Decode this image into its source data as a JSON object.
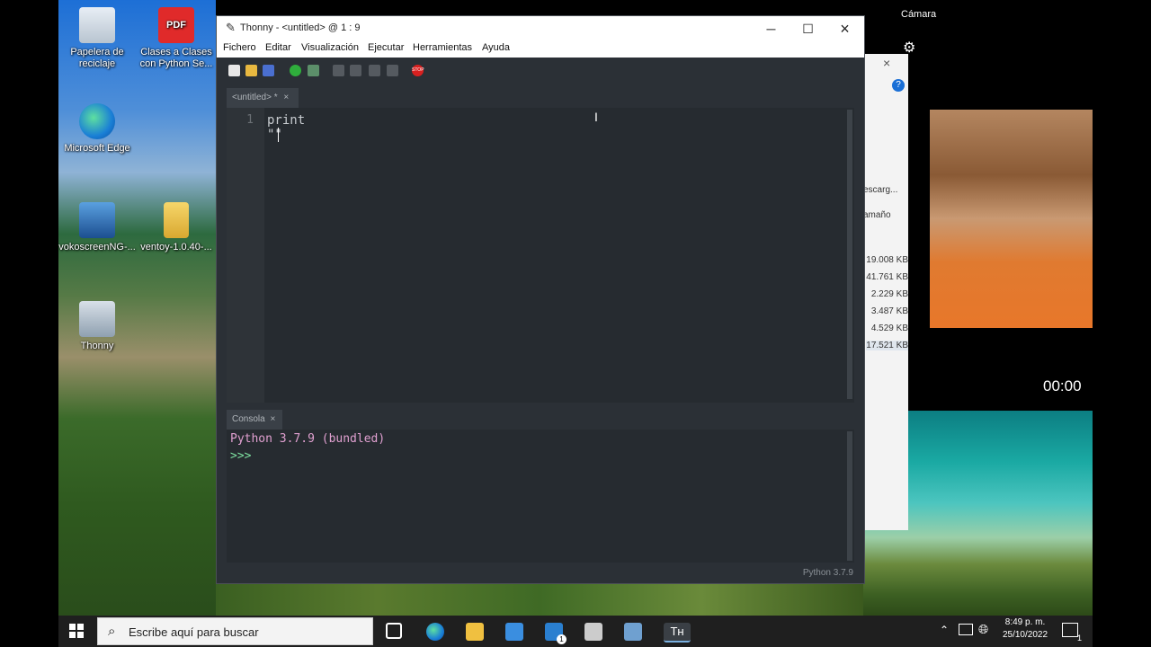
{
  "desktop": {
    "icons": [
      {
        "label": "Papelera de reciclaje",
        "icon": "recycle-bin-icon"
      },
      {
        "label": "Clases a Clases con Python Se...",
        "icon": "pdf-icon",
        "badge": "PDF"
      },
      {
        "label": "Microsoft Edge",
        "icon": "edge-icon"
      },
      {
        "label": "vokoscreenNG-...",
        "icon": "vokoscreen-icon"
      },
      {
        "label": "ventoy-1.0.40-...",
        "icon": "folder-zip-icon"
      },
      {
        "label": "Thonny",
        "icon": "thonny-icon"
      }
    ]
  },
  "thonny": {
    "title": "Thonny  -  <untitled>  @  1 : 9",
    "menu": [
      "Fichero",
      "Editar",
      "Visualización",
      "Ejecutar",
      "Herramientas",
      "Ayuda"
    ],
    "toolbar": [
      "new-file-icon",
      "open-file-icon",
      "save-icon",
      "run-icon",
      "debug-icon",
      "step-over-icon",
      "step-into-icon",
      "step-out-icon",
      "resume-icon",
      "stop-icon"
    ],
    "stop_label": "STOP",
    "editor_tab": "<untitled> *",
    "line_number": "1",
    "code": "print \"\"",
    "console_tab": "Consola",
    "console_lines": [
      "Python 3.7.9 (bundled)",
      ">>>"
    ],
    "status": "Python 3.7.9",
    "close_glyph": "×"
  },
  "explorer": {
    "partial_labels": [
      "escarg...",
      "amaño"
    ],
    "sizes": [
      "19.008 KB",
      "41.761 KB",
      "2.229 KB",
      "3.487 KB",
      "4.529 KB",
      "17.521 KB"
    ]
  },
  "camera": {
    "title": "Cámara",
    "timer": "00:00"
  },
  "taskbar": {
    "search_placeholder": "Escribe aquí para buscar",
    "time": "8:49 p. m.",
    "date": "25/10/2022",
    "notification_count": "1",
    "mail_badge": "1"
  },
  "colors": {
    "editor_bg": "#262b30",
    "prompt_green": "#7ee0a0",
    "console_text": "#e0a0d0"
  }
}
